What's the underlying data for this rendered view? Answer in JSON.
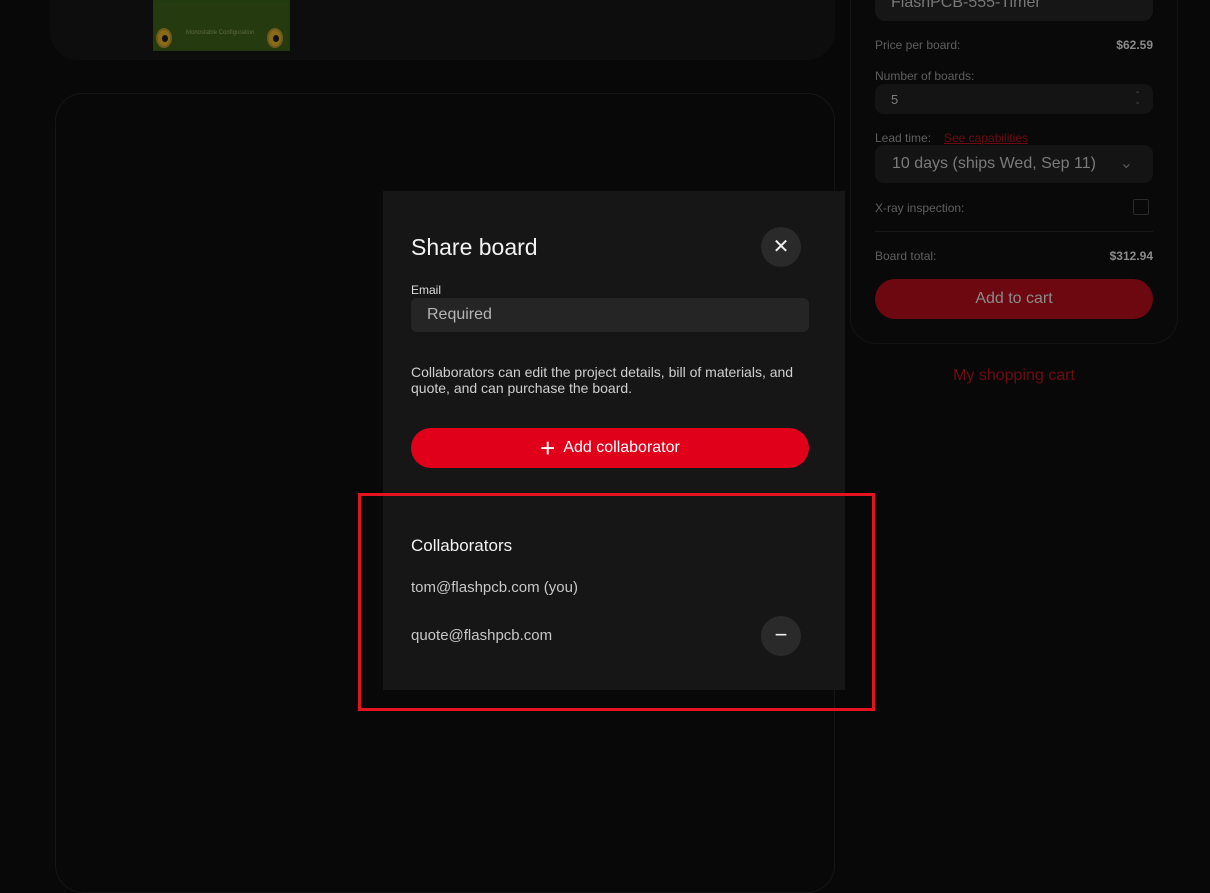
{
  "background": {
    "pcb_label": "Monostable Configuration",
    "order_panel": {
      "project_name": "FlashPCB-555-Timer",
      "price_per_board_label": "Price per board:",
      "price_per_board": "$62.59",
      "num_boards_label": "Number of boards:",
      "num_boards": "5",
      "lead_time_label": "Lead time:",
      "see_capabilities": "See capabilities",
      "lead_time": "10 days (ships Wed, Sep 11)",
      "xray_label": "X-ray inspection:",
      "xray_checked": false,
      "board_total_label": "Board total:",
      "board_total": "$312.94",
      "add_to_cart": "Add to cart",
      "shopping_cart": "My shopping cart"
    }
  },
  "modal": {
    "title": "Share board",
    "close_icon": "close-icon",
    "email_label": "Email",
    "email_placeholder": "Required",
    "email_value": "",
    "description": "Collaborators can edit the project details, bill of materials, and quote, and can purchase the board.",
    "add_button": "Add collaborator",
    "add_icon": "plus-icon",
    "collaborators_heading": "Collaborators",
    "collaborators": [
      {
        "email": "tom@flashpcb.com (you)",
        "removable": false
      },
      {
        "email": "quote@flashpcb.com",
        "removable": true
      }
    ]
  },
  "colors": {
    "accent": "#e0001a",
    "highlight": "#e3141f"
  }
}
